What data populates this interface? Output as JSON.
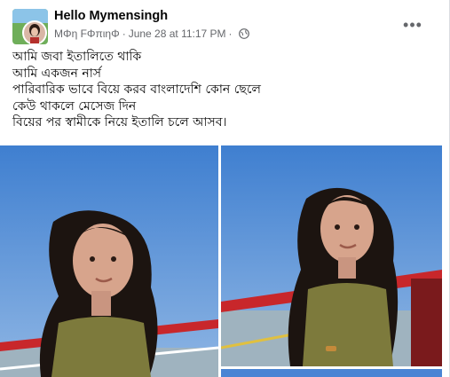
{
  "post": {
    "group_name": "Hello Mymensingh",
    "author": "MΦη FΦπιηΦ",
    "date": "June 28 at 11:17 PM",
    "audience_icon": "globe-icon",
    "more_icon": "more-options-icon",
    "more_label": "•••",
    "lines": [
      "আমি জবা ইতালিতে থাকি",
      "আমি একজন নার্স",
      "পারিবারিক ভাবে  বিয়ে করব বাংলাদেশি কোন ছেলে",
      "কেউ থাকলে মেসেজ দিন",
      "বিয়ের পর স্বামীকে নিয়ে ইতালি চলে আসব।"
    ]
  },
  "colors": {
    "sky": "#4a84d4",
    "rail": "#c8272b",
    "shirt": "#7d7a3c",
    "hair": "#1c1410"
  }
}
